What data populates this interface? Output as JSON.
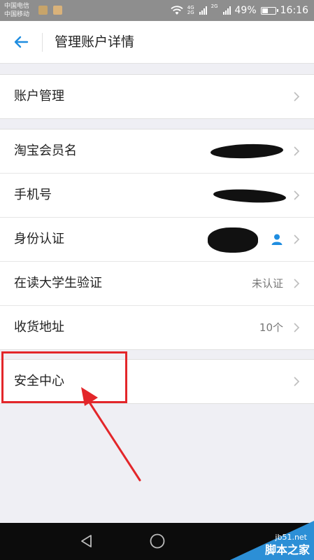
{
  "status_bar": {
    "carrier_1": "中国电信",
    "carrier_2": "中国移动",
    "net_1": "4G",
    "net_2": "2G",
    "net_3": "2G",
    "battery": "49%",
    "battery_level": 0.49,
    "time": "16:16"
  },
  "header": {
    "title": "管理账户详情",
    "back_icon": "arrow-left-icon"
  },
  "groups": [
    {
      "items": [
        {
          "label": "账户管理",
          "value": ""
        }
      ]
    },
    {
      "items": [
        {
          "label": "淘宝会员名",
          "value": ""
        },
        {
          "label": "手机号",
          "value": ""
        },
        {
          "label": "身份认证",
          "value": ""
        },
        {
          "label": "在读大学生验证",
          "value": "未认证"
        },
        {
          "label": "收货地址",
          "value": "10个"
        }
      ]
    },
    {
      "items": [
        {
          "label": "安全中心",
          "value": ""
        }
      ]
    }
  ],
  "colors": {
    "accent": "#1f8de0",
    "annotation": "#e3262a",
    "background": "#efeff4"
  },
  "watermark": {
    "url": "jb51.net",
    "text": "脚本之家"
  }
}
